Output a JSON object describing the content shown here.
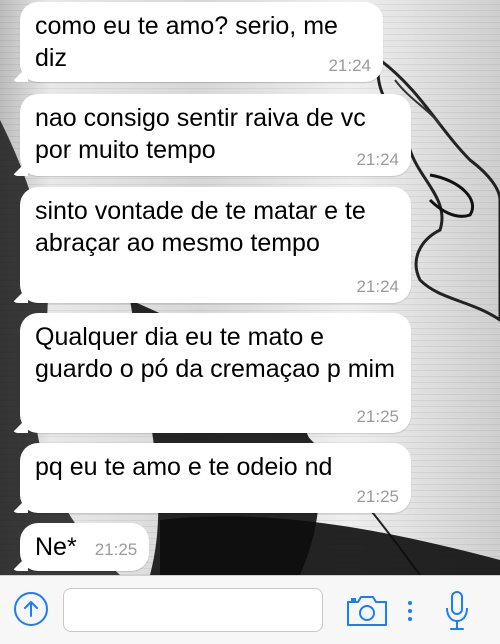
{
  "messages": [
    {
      "text": "como eu te amo? serio, me diz",
      "time": "21:24"
    },
    {
      "text": "nao consigo sentir raiva de vc por muito tempo",
      "time": "21:24"
    },
    {
      "text": "sinto vontade de te matar e te abraçar ao mesmo tempo",
      "time": "21:24"
    },
    {
      "text": "Qualquer dia eu te mato e guardo o pó da cremaçao p mim",
      "time": "21:25"
    },
    {
      "text": "pq eu te amo e te odeio nd",
      "time": "21:25"
    },
    {
      "text": "Ne*",
      "time": "21:25"
    }
  ],
  "composer": {
    "placeholder": ""
  },
  "icons": {
    "share": "share-arrow-icon",
    "camera": "camera-icon",
    "more": "more-dots-icon",
    "mic": "microphone-icon"
  },
  "colors": {
    "accent": "#1a7cff",
    "bubble": "#ffffff",
    "timestamp": "#9b9b9b"
  }
}
